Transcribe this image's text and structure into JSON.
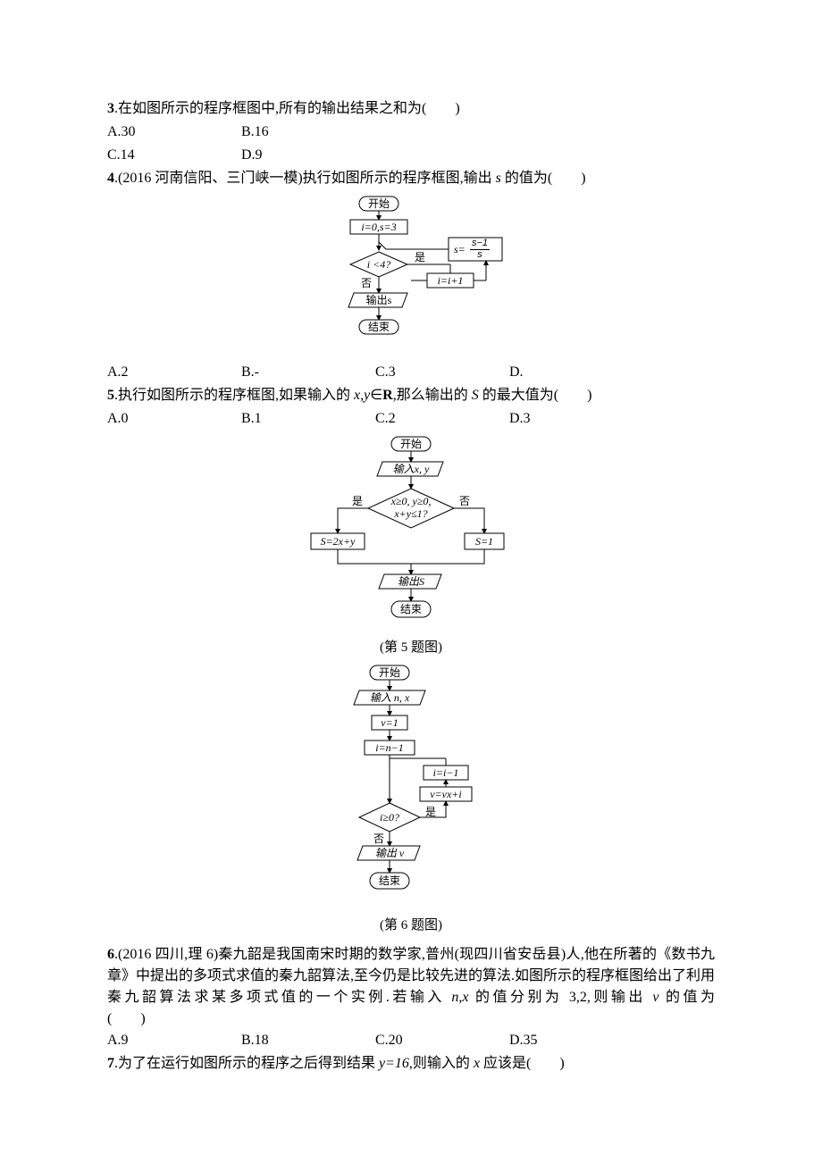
{
  "q3": {
    "num": "3",
    "text": ".在如图所示的程序框图中,所有的输出结果之和为(　　)",
    "options": {
      "A": "A.30",
      "B": "B.16",
      "C": "C.14",
      "D": "D.9"
    }
  },
  "q4": {
    "num": "4",
    "prefix": ".(2016 河南信阳、三门峡一模)执行如图所示的程序框图,输出 ",
    "var": "s",
    "suffix": " 的值为(　　)",
    "options": {
      "A": "A.2",
      "B": "B.-",
      "C": "C.3",
      "D": "D."
    },
    "fc": {
      "start": "开始",
      "init": "i=0,s=3",
      "update": "s= ",
      "frac_num": "s−1",
      "frac_den": "s",
      "cond": "i <4?",
      "yes": "是",
      "no": "否",
      "inc": "i=i+1",
      "out": "输出s",
      "end": "结束"
    }
  },
  "q5": {
    "num": "5",
    "prefix": ".执行如图所示的程序框图,如果输入的 ",
    "vars": "x,y",
    "inset": "∈",
    "rset": "R",
    "suffix": ",那么输出的 ",
    "svar": "S",
    "suffix2": " 的最大值为(　　)",
    "options": {
      "A": "A.0",
      "B": "B.1",
      "C": "C.2",
      "D": "D.3"
    },
    "fc": {
      "start": "开始",
      "input": "输入x, y",
      "cond1": "x≥0, y≥0,",
      "cond2": "x+y≤1?",
      "yes": "是",
      "no": "否",
      "left": "S=2x+y",
      "right": "S=1",
      "out": "输出S",
      "end": "结束"
    },
    "caption": "(第 5 题图)"
  },
  "q6": {
    "num": "6",
    "prefix": ".(2016 四川,理 6)秦九韶是我国南宋时期的数学家,普州(现四川省安岳县)人,他在所著的《数书九章》中提出的多项式求值的秦九韶算法,至今仍是比较先进的算法.如图所示的程序框图给出了利用秦九韶算法求某多项式值的一个实例.若输入 ",
    "vars": "n,x",
    "mid": " 的值分别为 3,2,则输出 ",
    "vvar": "v",
    "suffix": " 的值为　　　　　　　(　　)",
    "options": {
      "A": "A.9",
      "B": "B.18",
      "C": "C.20",
      "D": "D.35"
    },
    "fc": {
      "start": "开始",
      "input": "输入 n, x",
      "v1": "v=1",
      "in1": "i=n−1",
      "idec": "i=i−1",
      "vupd": "v=vx+i",
      "cond": "i≥0?",
      "yes": "是",
      "no": "否",
      "out": "输出 v",
      "end": "结束"
    },
    "caption": "(第 6 题图)"
  },
  "q7": {
    "num": "7",
    "prefix": ".为了在运行如图所示的程序之后得到结果 ",
    "eq": "y=16",
    "mid": ",则输入的 ",
    "xvar": "x",
    "suffix": " 应该是(　　)"
  }
}
